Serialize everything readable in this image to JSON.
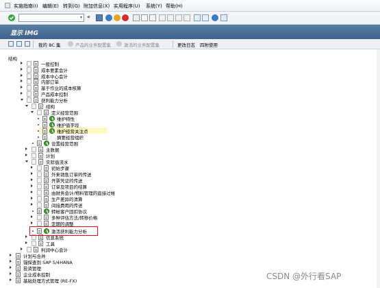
{
  "menubar": {
    "items": [
      "实施指南(I)",
      "编辑(E)",
      "转到(G)",
      "附加信息(X)",
      "实用程序(U)",
      "系统(Y)",
      "帮助(H)"
    ]
  },
  "title": "显示 IMG",
  "app_toolbar": {
    "buttons": [
      {
        "label": "我的 BC 集",
        "enabled": true
      },
      {
        "label": "产品的业务配置集",
        "enabled": false
      },
      {
        "label": "激活的业务配置集",
        "enabled": false
      },
      {
        "label": "更改日志",
        "enabled": true
      },
      {
        "label": "四附使用",
        "enabled": true
      }
    ]
  },
  "structure_label": "结构",
  "tree": [
    {
      "label": "一般控制"
    },
    {
      "label": "成本要素会计"
    },
    {
      "label": "成本中心会计"
    },
    {
      "label": "内部订单"
    },
    {
      "label": "基于作业的成本核算"
    },
    {
      "label": "产品成本控制"
    },
    {
      "label": "获利能力分析"
    },
    {
      "label": "结构"
    },
    {
      "label": "定义经营范围"
    },
    {
      "label": "维护特性"
    },
    {
      "label": "维护值字段"
    },
    {
      "label": "维护经营关注点"
    },
    {
      "label": "摘要经营组织"
    },
    {
      "label": "设置经营范围"
    },
    {
      "label": "主数据"
    },
    {
      "label": "计划"
    },
    {
      "label": "实际值流水"
    },
    {
      "label": "初始步骤"
    },
    {
      "label": "外来销售订单的传送"
    },
    {
      "label": "开票凭证的传送"
    },
    {
      "label": "订单及项目的结算"
    },
    {
      "label": "由财务会计/物料管理的直接过帐"
    },
    {
      "label": "生产差异的清算"
    },
    {
      "label": "间接费用的传送"
    },
    {
      "label": "转帐客户回扣协议"
    },
    {
      "label": "多种评估方法/转移价格"
    },
    {
      "label": "定期的调整"
    },
    {
      "label": "激活获利能力分析"
    },
    {
      "label": "信息系统"
    },
    {
      "label": "工具"
    },
    {
      "label": "利润中心会计"
    },
    {
      "label": "计划与合并"
    },
    {
      "label": "锚探查到 SAP S/4HANA"
    },
    {
      "label": "投资管理"
    },
    {
      "label": "企业成本控制"
    },
    {
      "label": "基础处理方式管理 (RE-FX)"
    }
  ],
  "watermark": "CSDN @外行看SAP"
}
